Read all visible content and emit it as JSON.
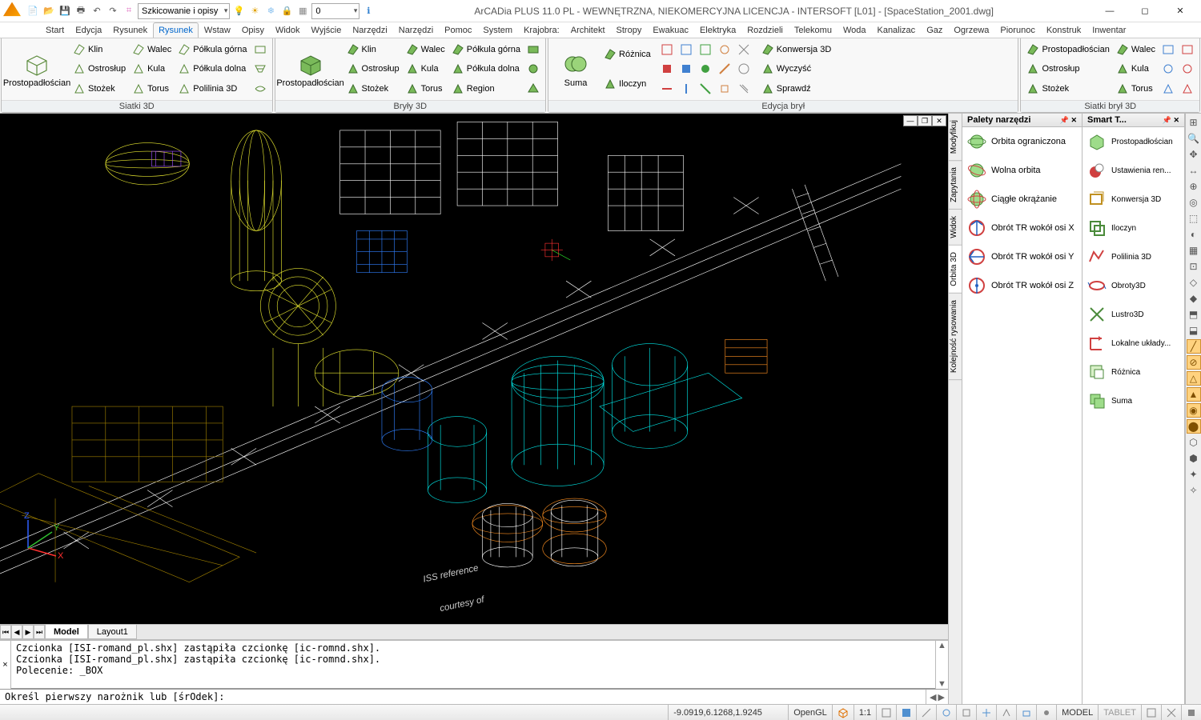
{
  "title": "ArCADia PLUS 11.0 PL - WEWNĘTRZNA, NIEKOMERCYJNA LICENCJA - INTERSOFT [L01] - [SpaceStation_2001.dwg]",
  "qat": {
    "combo1": "Szkicowanie i opisy",
    "combo2": "0"
  },
  "menu_tabs": [
    "Start",
    "Edycja",
    "Rysunek",
    "Rysunek",
    "Wstaw",
    "Opisy",
    "Widok",
    "Wyjście",
    "Narzędzi",
    "Narzędzi",
    "Pomoc",
    "System",
    "Krajobra:",
    "Architekt",
    "Stropy",
    "Ewakuac",
    "Elektryka",
    "Rozdzieli",
    "Telekomu",
    "Woda",
    "Kanalizac",
    "Gaz",
    "Ogrzewa",
    "Piorunoc",
    "Konstruk",
    "Inwentar"
  ],
  "menu_active": 3,
  "ribbon": {
    "panel1": {
      "title": "Siatki 3D",
      "big": "Prostopadłościan",
      "col1": [
        "Klin",
        "Ostrosłup",
        "Stożek"
      ],
      "col2": [
        "Walec",
        "Kula",
        "Torus"
      ],
      "col3": [
        "Półkula górna",
        "Półkula dolna",
        "Polilinia 3D"
      ]
    },
    "panel2": {
      "title": "Bryły 3D",
      "big": "Prostopadłościan",
      "col1": [
        "Klin",
        "Ostrosłup",
        "Stożek"
      ],
      "col2": [
        "Walec",
        "Kula",
        "Torus"
      ],
      "col3": [
        "Półkula górna",
        "Półkula dolna",
        "Region"
      ]
    },
    "panel3": {
      "title": "Edycja brył",
      "big": "Suma",
      "col1": [
        "Różnica",
        "Iloczyn"
      ]
    },
    "panel4": {
      "title": "",
      "col1": [
        "Konwersja 3D",
        "Wyczyść",
        "Sprawdź"
      ]
    },
    "panel5": {
      "title": "Siatki brył 3D",
      "col1": [
        "Prostopadłościan",
        "Ostrosłup",
        "Stożek"
      ],
      "col2": [
        "Walec",
        "Kula",
        "Torus"
      ]
    }
  },
  "side_tabs": [
    "Modyfikuj",
    "Zapytania",
    "Widok",
    "Orbita 3D",
    "Kolejność rysowania"
  ],
  "side_active": 3,
  "palette1": {
    "title": "Palety narzędzi",
    "items": [
      "Orbita ograniczona",
      "Wolna orbita",
      "Ciągłe okrążanie",
      "Obrót TR wokół osi X",
      "Obrót TR wokół osi Y",
      "Obrót TR wokół osi Z"
    ]
  },
  "palette2": {
    "title": "Smart T...",
    "items": [
      "Prostopadłościan",
      "Ustawienia ren...",
      "Konwersja 3D",
      "Iloczyn",
      "Polilinia 3D",
      "Obroty3D",
      "Lustro3D",
      "Lokalne układy...",
      "Różnica",
      "Suma"
    ]
  },
  "doc_tabs": [
    "Model",
    "Layout1"
  ],
  "doc_active": 0,
  "cmd_log": "Czcionka [ISI-romand_pl.shx] zastąpiła czcionkę [ic-romnd.shx].\nCzcionka [ISI-romand_pl.shx] zastąpiła czcionkę [ic-romnd.shx].\nPolecenie: _BOX",
  "cmd_input": "Określ pierwszy narożnik lub [śrOdek]:",
  "status": {
    "coords": "-9.0919,6.1268,1.9245",
    "opengl": "OpenGL",
    "ratio": "1:1",
    "model": "MODEL",
    "tablet": "TABLET"
  },
  "viewport_text": [
    "ISS reference",
    "courtesy of"
  ],
  "colors": {
    "accent": "#e07000",
    "wire_yellow": "#e8e830",
    "wire_cyan": "#00e8e8",
    "wire_blue": "#3080ff",
    "wire_white": "#ffffff",
    "wire_orange": "#ff9020",
    "wire_purple": "#a050ff"
  }
}
